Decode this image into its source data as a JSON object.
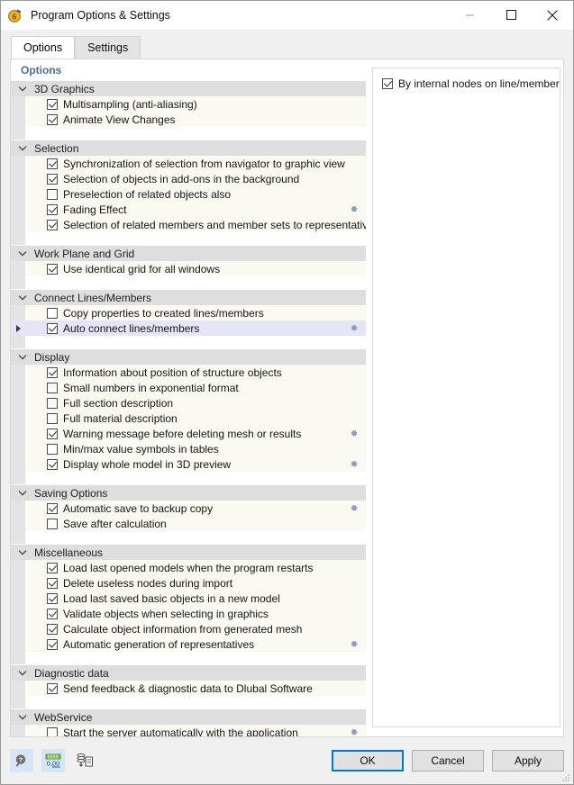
{
  "window": {
    "title": "Program Options & Settings",
    "app_icon": "dlubal-app-icon",
    "minimize_label": "Minimize",
    "maximize_label": "Maximize",
    "close_label": "Close"
  },
  "tabs": [
    {
      "label": "Options",
      "active": true
    },
    {
      "label": "Settings",
      "active": false
    }
  ],
  "left_pane": {
    "title": "Options",
    "sections": [
      {
        "label": "3D Graphics",
        "expanded": true,
        "rows": [
          {
            "label": "Multisampling (anti-aliasing)",
            "checked": true,
            "gear": false,
            "selected": false,
            "expander": false
          },
          {
            "label": "Animate View Changes",
            "checked": true,
            "gear": false,
            "selected": false,
            "expander": false
          }
        ]
      },
      {
        "label": "Selection",
        "expanded": true,
        "rows": [
          {
            "label": "Synchronization of selection from navigator to graphic view",
            "checked": true,
            "gear": false,
            "selected": false,
            "expander": false
          },
          {
            "label": "Selection of objects in add-ons in the background",
            "checked": true,
            "gear": false,
            "selected": false,
            "expander": false
          },
          {
            "label": "Preselection of related objects also",
            "checked": false,
            "gear": false,
            "selected": false,
            "expander": false
          },
          {
            "label": "Fading Effect",
            "checked": true,
            "gear": true,
            "selected": false,
            "expander": false
          },
          {
            "label": "Selection of related members and member sets to representatives",
            "checked": true,
            "gear": false,
            "selected": false,
            "expander": false
          }
        ]
      },
      {
        "label": "Work Plane and Grid",
        "expanded": true,
        "rows": [
          {
            "label": "Use identical grid for all windows",
            "checked": true,
            "gear": false,
            "selected": false,
            "expander": false
          }
        ]
      },
      {
        "label": "Connect Lines/Members",
        "expanded": true,
        "rows": [
          {
            "label": "Copy properties to created lines/members",
            "checked": false,
            "gear": false,
            "selected": false,
            "expander": false
          },
          {
            "label": "Auto connect lines/members",
            "checked": true,
            "gear": true,
            "selected": true,
            "expander": true
          }
        ]
      },
      {
        "label": "Display",
        "expanded": true,
        "rows": [
          {
            "label": "Information about position of structure objects",
            "checked": true,
            "gear": false,
            "selected": false,
            "expander": false
          },
          {
            "label": "Small numbers in exponential format",
            "checked": false,
            "gear": false,
            "selected": false,
            "expander": false
          },
          {
            "label": "Full section description",
            "checked": false,
            "gear": false,
            "selected": false,
            "expander": false
          },
          {
            "label": "Full material description",
            "checked": false,
            "gear": false,
            "selected": false,
            "expander": false
          },
          {
            "label": "Warning message before deleting mesh or results",
            "checked": true,
            "gear": true,
            "selected": false,
            "expander": false
          },
          {
            "label": "Min/max value symbols in tables",
            "checked": false,
            "gear": false,
            "selected": false,
            "expander": false
          },
          {
            "label": "Display whole model in 3D preview",
            "checked": true,
            "gear": true,
            "selected": false,
            "expander": false
          }
        ]
      },
      {
        "label": "Saving Options",
        "expanded": true,
        "rows": [
          {
            "label": "Automatic save to backup copy",
            "checked": true,
            "gear": true,
            "selected": false,
            "expander": false
          },
          {
            "label": "Save after calculation",
            "checked": false,
            "gear": false,
            "selected": false,
            "expander": false
          }
        ]
      },
      {
        "label": "Miscellaneous",
        "expanded": true,
        "rows": [
          {
            "label": "Load last opened models when the program restarts",
            "checked": true,
            "gear": false,
            "selected": false,
            "expander": false
          },
          {
            "label": "Delete useless nodes during import",
            "checked": true,
            "gear": false,
            "selected": false,
            "expander": false
          },
          {
            "label": "Load last saved basic objects in a new model",
            "checked": true,
            "gear": false,
            "selected": false,
            "expander": false
          },
          {
            "label": "Validate objects when selecting in graphics",
            "checked": true,
            "gear": false,
            "selected": false,
            "expander": false
          },
          {
            "label": "Calculate object information from generated mesh",
            "checked": true,
            "gear": false,
            "selected": false,
            "expander": false
          },
          {
            "label": "Automatic generation of representatives",
            "checked": true,
            "gear": true,
            "selected": false,
            "expander": false
          }
        ]
      },
      {
        "label": "Diagnostic data",
        "expanded": true,
        "rows": [
          {
            "label": "Send feedback & diagnostic data to Dlubal Software",
            "checked": true,
            "gear": false,
            "selected": false,
            "expander": false
          }
        ]
      },
      {
        "label": "WebService",
        "expanded": true,
        "rows": [
          {
            "label": "Start the server automatically with the application",
            "checked": false,
            "gear": true,
            "selected": false,
            "expander": false
          }
        ]
      }
    ]
  },
  "right_pane": {
    "rows": [
      {
        "label": "By internal nodes on line/member",
        "checked": true
      }
    ]
  },
  "bottom_bar": {
    "tools": [
      {
        "name": "help-icon",
        "label": "Help"
      },
      {
        "name": "number-format-icon",
        "label": "0,00"
      },
      {
        "name": "copy-settings-icon",
        "label": "Copy settings"
      }
    ],
    "buttons": [
      {
        "label": "OK",
        "primary": true
      },
      {
        "label": "Cancel",
        "primary": false
      },
      {
        "label": "Apply",
        "primary": false
      }
    ]
  },
  "colors": {
    "accent": "#0078d7",
    "section_header_bg": "#dedede",
    "row_bg": "#fafaf3",
    "selected_row_bg": "#e6e5f7",
    "pane_title": "#4a6f97",
    "gear": "#8a9cc4"
  }
}
